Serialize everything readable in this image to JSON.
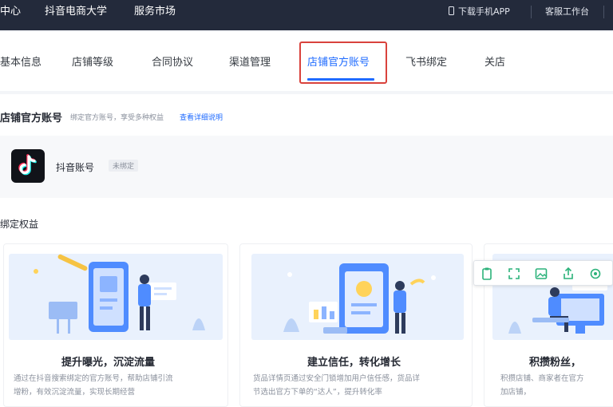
{
  "topbar": {
    "nav": [
      "中心",
      "抖音电商大学",
      "服务市场"
    ],
    "download_app": "下载手机APP",
    "workbench": "客服工作台"
  },
  "tabs": [
    {
      "label": "基本信息",
      "active": false
    },
    {
      "label": "店铺等级",
      "active": false
    },
    {
      "label": "合同协议",
      "active": false
    },
    {
      "label": "渠道管理",
      "active": false
    },
    {
      "label": "店铺官方账号",
      "active": true
    },
    {
      "label": "飞书绑定",
      "active": false
    },
    {
      "label": "关店",
      "active": false
    }
  ],
  "section": {
    "title": "店铺官方账号",
    "subtitle": "绑定官方账号，享受多种权益",
    "link": "查看详细说明"
  },
  "account": {
    "name": "抖音账号",
    "status": "未绑定",
    "logo_icon": "tiktok-logo-icon"
  },
  "bind_benefits_title": "绑定权益",
  "benefits": [
    {
      "title": "提升曝光，沉淀流量",
      "desc": [
        "通过在抖音搜索绑定的官方账号，帮助店铺引流",
        "增粉，有效沉淀流量，实现长期经营"
      ]
    },
    {
      "title": "建立信任，转化增长",
      "desc": [
        "货品详情页通过安全门锁增加用户信任感，货品详",
        "节选出官方下单的“达人”，提升转化率"
      ]
    },
    {
      "title": "积攒粉丝，",
      "desc": [
        "积攒店铺、商家者在官方",
        "加店铺，"
      ]
    }
  ],
  "toolbar_icons": [
    "clipboard-icon",
    "fullscreen-icon",
    "image-icon",
    "share-icon",
    "settings-icon"
  ],
  "colors": {
    "topbar_bg": "#232a3b",
    "accent": "#1f6bff",
    "highlight": "#d9423c",
    "toolbar_icon": "#2bb27a"
  }
}
